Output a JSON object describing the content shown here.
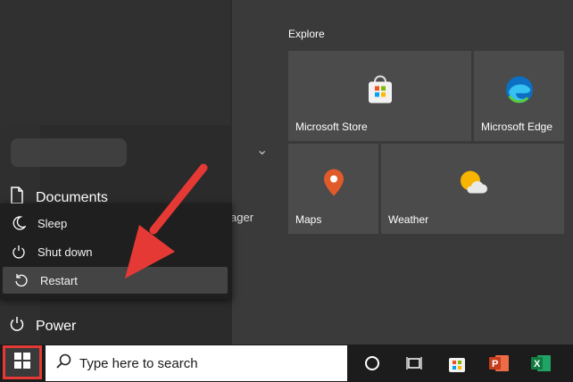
{
  "rail": {
    "documents_label": "Documents",
    "power_label": "Power"
  },
  "partial_behind_text": "ager",
  "power_menu": {
    "sleep_label": "Sleep",
    "shutdown_label": "Shut down",
    "restart_label": "Restart"
  },
  "tiles": {
    "section_title": "Explore",
    "store_label": "Microsoft Store",
    "edge_label": "Microsoft Edge",
    "maps_label": "Maps",
    "weather_label": "Weather"
  },
  "taskbar": {
    "search_placeholder": "Type here to search"
  },
  "colors": {
    "highlight_border": "#e53935",
    "annotation_arrow": "#e53935"
  }
}
